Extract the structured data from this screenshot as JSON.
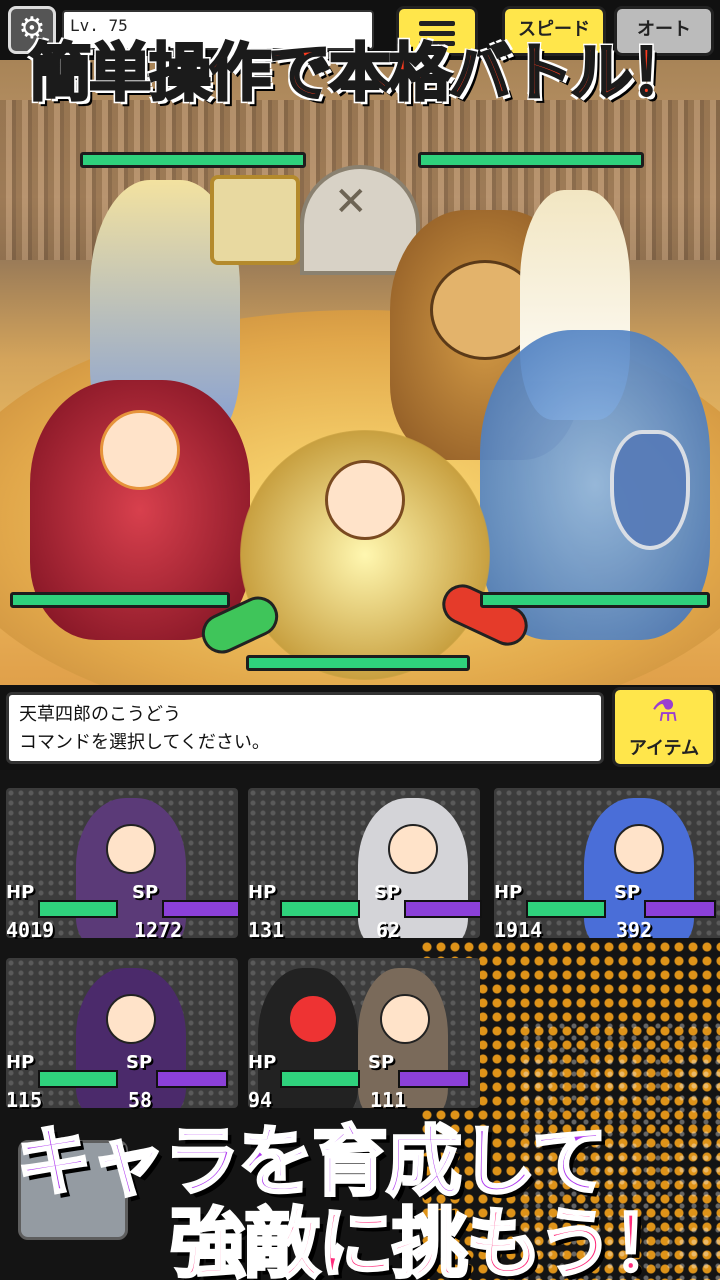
{
  "top_bar": {
    "level": "Lv. 75",
    "speed_label": "スピード",
    "auto_label": "オート"
  },
  "banner": {
    "title": "簡単操作で本格バトル！"
  },
  "battle": {
    "enemy_hp_bars": 2,
    "ally_hp_bars": 3
  },
  "message": {
    "line1": "天草四郎のこうどう",
    "line2": "コマンドを選択してください。"
  },
  "item_button": {
    "label": "アイテム",
    "icon": "potion-icon"
  },
  "party": [
    {
      "hp_label": "HP",
      "sp_label": "SP",
      "hp": "4019",
      "sp": "1272",
      "hp_ratio": 0.9,
      "sp_ratio": 0.9
    },
    {
      "hp_label": "HP",
      "sp_label": "SP",
      "hp": "131",
      "sp": "62",
      "hp_ratio": 0.9,
      "sp_ratio": 0.9
    },
    {
      "hp_label": "HP",
      "sp_label": "SP",
      "hp": "1914",
      "sp": "392",
      "hp_ratio": 0.9,
      "sp_ratio": 0.9
    },
    {
      "hp_label": "HP",
      "sp_label": "SP",
      "hp": "115",
      "sp": "58",
      "hp_ratio": 0.9,
      "sp_ratio": 0.9
    },
    {
      "hp_label": "HP",
      "sp_label": "SP",
      "hp": "94",
      "sp": "111",
      "hp_ratio": 0.9,
      "sp_ratio": 0.9
    }
  ],
  "captions": {
    "line1": "キャラを育成して",
    "line2": "強敵に挑もう！"
  },
  "colors": {
    "accent_yellow": "#ffe64b",
    "hp_green": "#2fd17c",
    "sp_purple": "#8b40d8",
    "title_red": "#ff3b1f",
    "caption_purple": "#b03cf0",
    "caption_pink": "#ff2b7b"
  }
}
